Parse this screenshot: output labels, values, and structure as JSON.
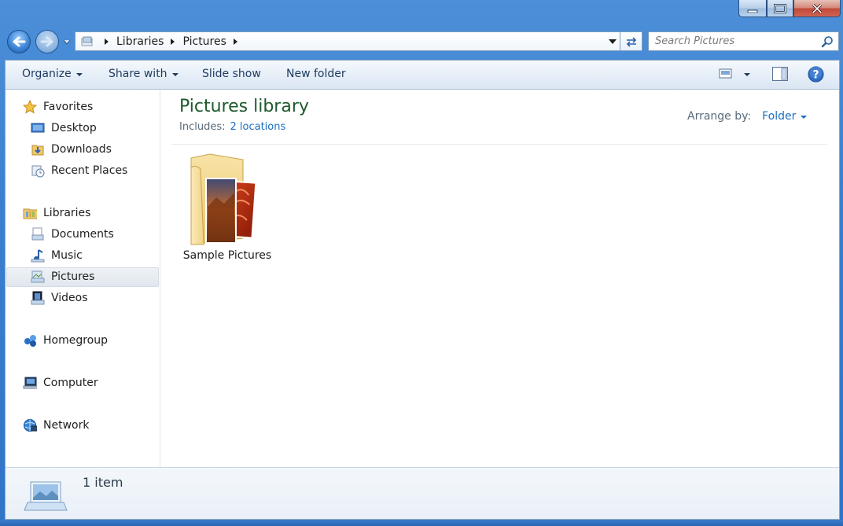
{
  "window": {
    "minimize_icon": "minimize-icon",
    "maximize_icon": "maximize-icon",
    "close_icon": "close-icon"
  },
  "navigation": {
    "back_icon": "back-arrow-icon",
    "forward_icon": "forward-arrow-icon"
  },
  "address_bar": {
    "crumbs": [
      "Libraries",
      "Pictures"
    ],
    "refresh_icon": "refresh-icon"
  },
  "search": {
    "placeholder": "Search Pictures"
  },
  "toolbar": {
    "organize": "Organize",
    "share_with": "Share with",
    "slide_show": "Slide show",
    "new_folder": "New folder",
    "change_view_icon": "change-view-icon",
    "preview_pane_icon": "preview-pane-icon",
    "help_icon": "help-icon"
  },
  "sidebar": {
    "favorites": {
      "label": "Favorites",
      "items": [
        {
          "label": "Desktop",
          "icon": "desktop-icon"
        },
        {
          "label": "Downloads",
          "icon": "downloads-icon"
        },
        {
          "label": "Recent Places",
          "icon": "recent-places-icon"
        }
      ]
    },
    "libraries": {
      "label": "Libraries",
      "items": [
        {
          "label": "Documents",
          "icon": "documents-icon"
        },
        {
          "label": "Music",
          "icon": "music-icon"
        },
        {
          "label": "Pictures",
          "icon": "pictures-icon",
          "selected": true
        },
        {
          "label": "Videos",
          "icon": "videos-icon"
        }
      ]
    },
    "homegroup": "Homegroup",
    "computer": "Computer",
    "network": "Network"
  },
  "library": {
    "title": "Pictures library",
    "includes_label": "Includes:",
    "includes_link": "2 locations",
    "arrange_label": "Arrange by:",
    "arrange_value": "Folder"
  },
  "items": [
    {
      "name": "Sample Pictures",
      "icon": "picture-folder-icon"
    }
  ],
  "status": {
    "count": "1 item"
  },
  "colors": {
    "title_green": "#1e5a2e",
    "link_blue": "#1c6fc0",
    "frame_blue": "#3a7fd0"
  }
}
